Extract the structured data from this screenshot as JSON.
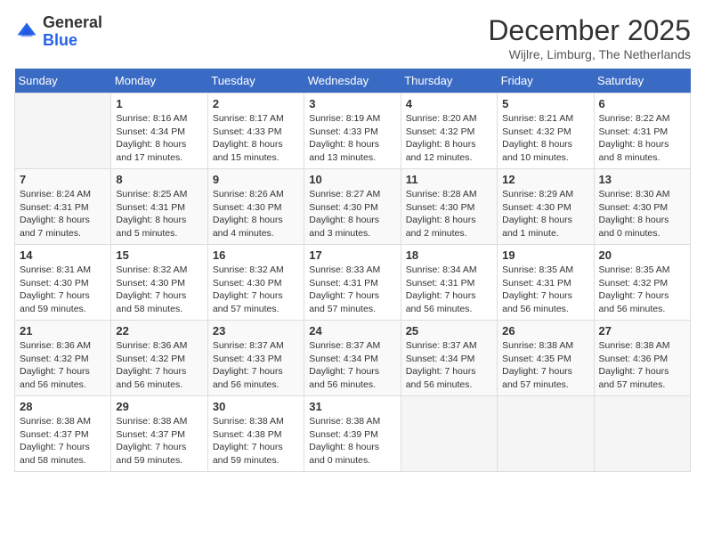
{
  "header": {
    "logo": {
      "line1": "General",
      "line2": "Blue"
    },
    "title": "December 2025",
    "location": "Wijlre, Limburg, The Netherlands"
  },
  "weekdays": [
    "Sunday",
    "Monday",
    "Tuesday",
    "Wednesday",
    "Thursday",
    "Friday",
    "Saturday"
  ],
  "weeks": [
    [
      {
        "day": "",
        "sunrise": "",
        "sunset": "",
        "daylight": ""
      },
      {
        "day": "1",
        "sunrise": "Sunrise: 8:16 AM",
        "sunset": "Sunset: 4:34 PM",
        "daylight": "Daylight: 8 hours and 17 minutes."
      },
      {
        "day": "2",
        "sunrise": "Sunrise: 8:17 AM",
        "sunset": "Sunset: 4:33 PM",
        "daylight": "Daylight: 8 hours and 15 minutes."
      },
      {
        "day": "3",
        "sunrise": "Sunrise: 8:19 AM",
        "sunset": "Sunset: 4:33 PM",
        "daylight": "Daylight: 8 hours and 13 minutes."
      },
      {
        "day": "4",
        "sunrise": "Sunrise: 8:20 AM",
        "sunset": "Sunset: 4:32 PM",
        "daylight": "Daylight: 8 hours and 12 minutes."
      },
      {
        "day": "5",
        "sunrise": "Sunrise: 8:21 AM",
        "sunset": "Sunset: 4:32 PM",
        "daylight": "Daylight: 8 hours and 10 minutes."
      },
      {
        "day": "6",
        "sunrise": "Sunrise: 8:22 AM",
        "sunset": "Sunset: 4:31 PM",
        "daylight": "Daylight: 8 hours and 8 minutes."
      }
    ],
    [
      {
        "day": "7",
        "sunrise": "Sunrise: 8:24 AM",
        "sunset": "Sunset: 4:31 PM",
        "daylight": "Daylight: 8 hours and 7 minutes."
      },
      {
        "day": "8",
        "sunrise": "Sunrise: 8:25 AM",
        "sunset": "Sunset: 4:31 PM",
        "daylight": "Daylight: 8 hours and 5 minutes."
      },
      {
        "day": "9",
        "sunrise": "Sunrise: 8:26 AM",
        "sunset": "Sunset: 4:30 PM",
        "daylight": "Daylight: 8 hours and 4 minutes."
      },
      {
        "day": "10",
        "sunrise": "Sunrise: 8:27 AM",
        "sunset": "Sunset: 4:30 PM",
        "daylight": "Daylight: 8 hours and 3 minutes."
      },
      {
        "day": "11",
        "sunrise": "Sunrise: 8:28 AM",
        "sunset": "Sunset: 4:30 PM",
        "daylight": "Daylight: 8 hours and 2 minutes."
      },
      {
        "day": "12",
        "sunrise": "Sunrise: 8:29 AM",
        "sunset": "Sunset: 4:30 PM",
        "daylight": "Daylight: 8 hours and 1 minute."
      },
      {
        "day": "13",
        "sunrise": "Sunrise: 8:30 AM",
        "sunset": "Sunset: 4:30 PM",
        "daylight": "Daylight: 8 hours and 0 minutes."
      }
    ],
    [
      {
        "day": "14",
        "sunrise": "Sunrise: 8:31 AM",
        "sunset": "Sunset: 4:30 PM",
        "daylight": "Daylight: 7 hours and 59 minutes."
      },
      {
        "day": "15",
        "sunrise": "Sunrise: 8:32 AM",
        "sunset": "Sunset: 4:30 PM",
        "daylight": "Daylight: 7 hours and 58 minutes."
      },
      {
        "day": "16",
        "sunrise": "Sunrise: 8:32 AM",
        "sunset": "Sunset: 4:30 PM",
        "daylight": "Daylight: 7 hours and 57 minutes."
      },
      {
        "day": "17",
        "sunrise": "Sunrise: 8:33 AM",
        "sunset": "Sunset: 4:31 PM",
        "daylight": "Daylight: 7 hours and 57 minutes."
      },
      {
        "day": "18",
        "sunrise": "Sunrise: 8:34 AM",
        "sunset": "Sunset: 4:31 PM",
        "daylight": "Daylight: 7 hours and 56 minutes."
      },
      {
        "day": "19",
        "sunrise": "Sunrise: 8:35 AM",
        "sunset": "Sunset: 4:31 PM",
        "daylight": "Daylight: 7 hours and 56 minutes."
      },
      {
        "day": "20",
        "sunrise": "Sunrise: 8:35 AM",
        "sunset": "Sunset: 4:32 PM",
        "daylight": "Daylight: 7 hours and 56 minutes."
      }
    ],
    [
      {
        "day": "21",
        "sunrise": "Sunrise: 8:36 AM",
        "sunset": "Sunset: 4:32 PM",
        "daylight": "Daylight: 7 hours and 56 minutes."
      },
      {
        "day": "22",
        "sunrise": "Sunrise: 8:36 AM",
        "sunset": "Sunset: 4:32 PM",
        "daylight": "Daylight: 7 hours and 56 minutes."
      },
      {
        "day": "23",
        "sunrise": "Sunrise: 8:37 AM",
        "sunset": "Sunset: 4:33 PM",
        "daylight": "Daylight: 7 hours and 56 minutes."
      },
      {
        "day": "24",
        "sunrise": "Sunrise: 8:37 AM",
        "sunset": "Sunset: 4:34 PM",
        "daylight": "Daylight: 7 hours and 56 minutes."
      },
      {
        "day": "25",
        "sunrise": "Sunrise: 8:37 AM",
        "sunset": "Sunset: 4:34 PM",
        "daylight": "Daylight: 7 hours and 56 minutes."
      },
      {
        "day": "26",
        "sunrise": "Sunrise: 8:38 AM",
        "sunset": "Sunset: 4:35 PM",
        "daylight": "Daylight: 7 hours and 57 minutes."
      },
      {
        "day": "27",
        "sunrise": "Sunrise: 8:38 AM",
        "sunset": "Sunset: 4:36 PM",
        "daylight": "Daylight: 7 hours and 57 minutes."
      }
    ],
    [
      {
        "day": "28",
        "sunrise": "Sunrise: 8:38 AM",
        "sunset": "Sunset: 4:37 PM",
        "daylight": "Daylight: 7 hours and 58 minutes."
      },
      {
        "day": "29",
        "sunrise": "Sunrise: 8:38 AM",
        "sunset": "Sunset: 4:37 PM",
        "daylight": "Daylight: 7 hours and 59 minutes."
      },
      {
        "day": "30",
        "sunrise": "Sunrise: 8:38 AM",
        "sunset": "Sunset: 4:38 PM",
        "daylight": "Daylight: 7 hours and 59 minutes."
      },
      {
        "day": "31",
        "sunrise": "Sunrise: 8:38 AM",
        "sunset": "Sunset: 4:39 PM",
        "daylight": "Daylight: 8 hours and 0 minutes."
      },
      {
        "day": "",
        "sunrise": "",
        "sunset": "",
        "daylight": ""
      },
      {
        "day": "",
        "sunrise": "",
        "sunset": "",
        "daylight": ""
      },
      {
        "day": "",
        "sunrise": "",
        "sunset": "",
        "daylight": ""
      }
    ]
  ]
}
